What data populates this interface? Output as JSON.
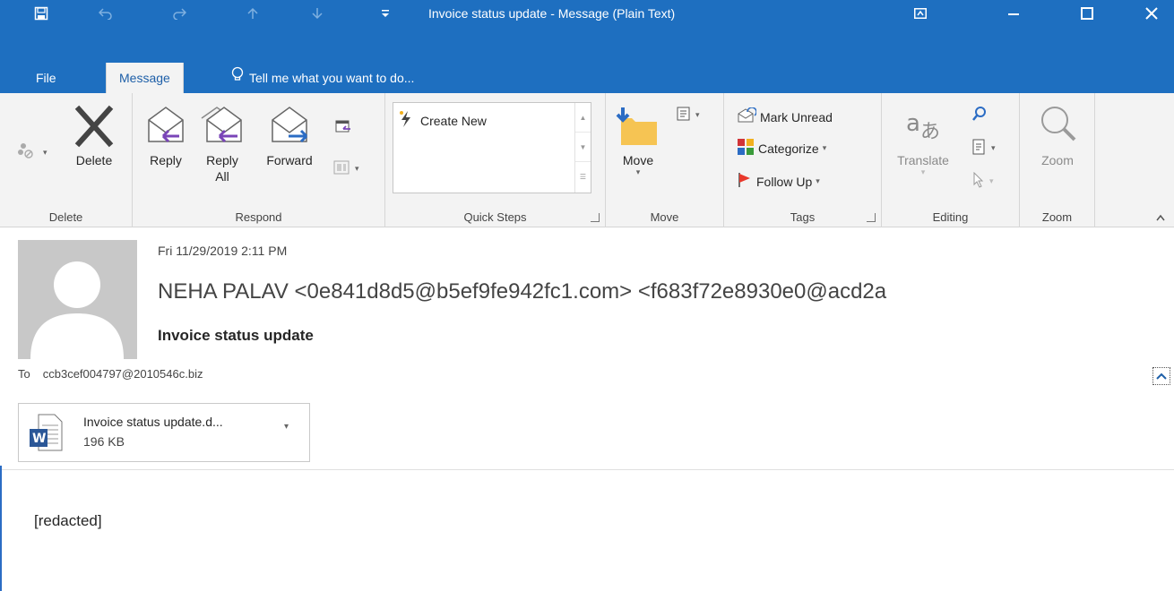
{
  "window": {
    "title": "Invoice status update - Message (Plain Text)",
    "icons": [
      "save-icon",
      "undo-icon",
      "redo-icon",
      "up-arrow-icon",
      "down-arrow-icon",
      "customize-qat-icon",
      "ribbon-display-icon",
      "minimize-icon",
      "maximize-icon",
      "close-icon"
    ]
  },
  "tabs": {
    "file": "File",
    "message": "Message",
    "tell_me": "Tell me what you want to do..."
  },
  "ribbon": {
    "delete_group": {
      "label": "Delete",
      "delete_btn": "Delete"
    },
    "respond_group": {
      "label": "Respond",
      "reply": "Reply",
      "reply_all_1": "Reply",
      "reply_all_2": "All",
      "forward": "Forward"
    },
    "quick_steps_group": {
      "label": "Quick Steps",
      "create_new": "Create New"
    },
    "move_group": {
      "label": "Move",
      "move_btn": "Move"
    },
    "tags_group": {
      "label": "Tags",
      "mark_unread": "Mark Unread",
      "categorize": "Categorize",
      "follow_up": "Follow Up"
    },
    "editing_group": {
      "label": "Editing",
      "translate": "Translate"
    },
    "zoom_group": {
      "label": "Zoom",
      "zoom_btn": "Zoom"
    }
  },
  "message": {
    "date": "Fri 11/29/2019 2:11 PM",
    "sender": "NEHA PALAV <0e841d8d5@b5ef9fe942fc1.com> <f683f72e8930e0@acd2a",
    "subject": "Invoice status update",
    "to_label": "To",
    "to_address": "ccb3cef004797@2010546c.biz",
    "body": "[redacted]"
  },
  "attachment": {
    "name": "Invoice status update.d...",
    "size": "196 KB"
  },
  "colors": {
    "accent": "#1e6fc0",
    "ribbon_bg": "#f3f3f3",
    "follow_up_flag": "#e8382b"
  }
}
